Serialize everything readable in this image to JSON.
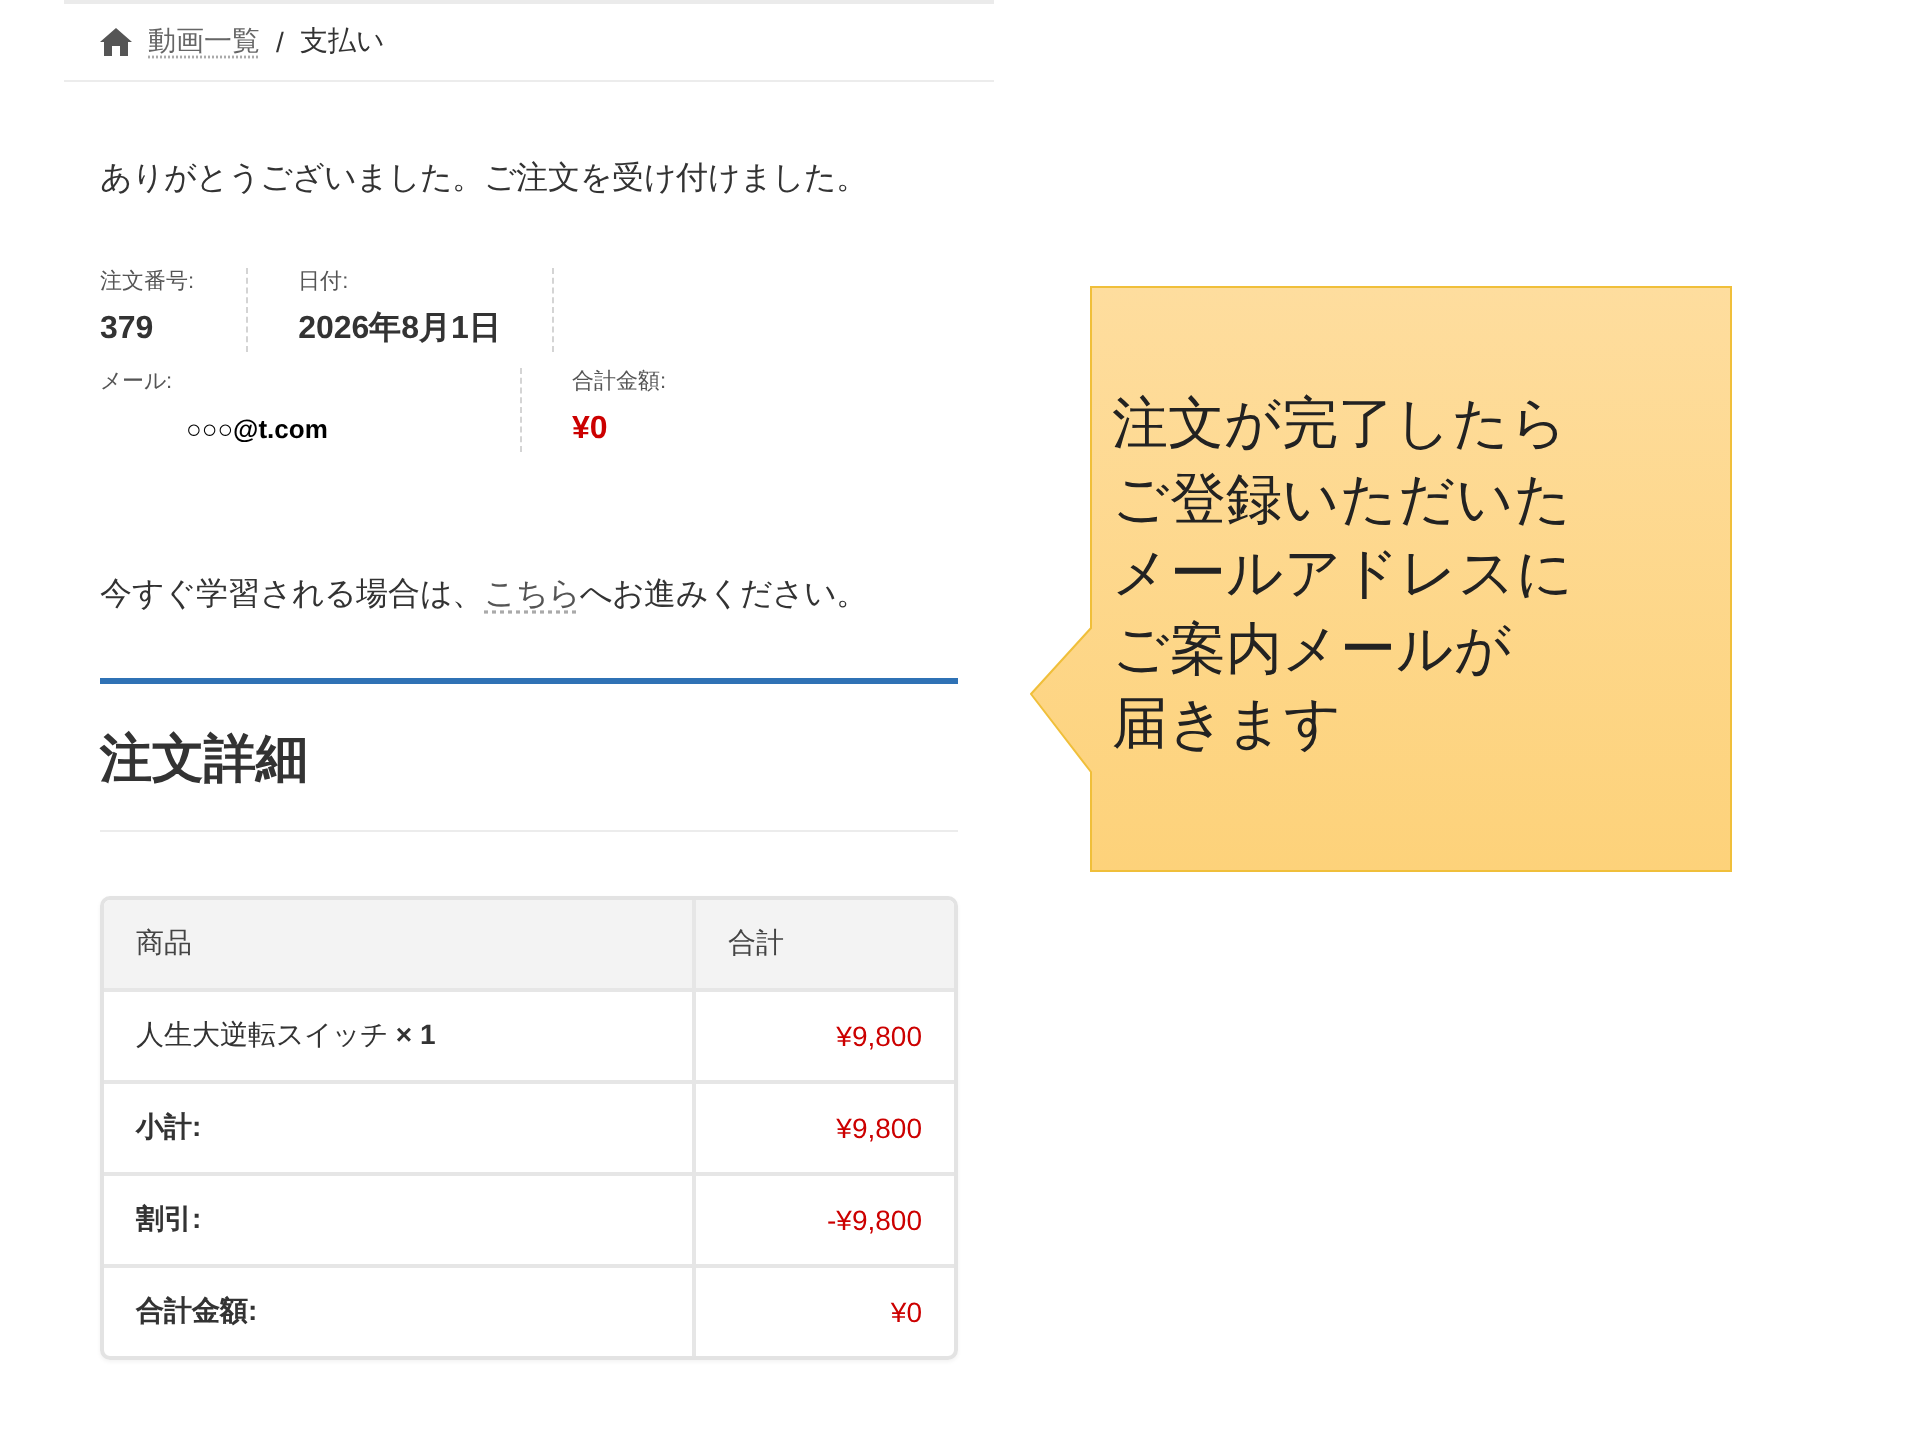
{
  "breadcrumb": {
    "items": [
      {
        "label": "動画一覧",
        "kind": "link"
      },
      {
        "label": "支払い",
        "kind": "current"
      }
    ],
    "separator": "/"
  },
  "thank_you": "ありがとうございました。ご注文を受け付けました。",
  "order_overview": [
    {
      "label": "注文番号:",
      "value": "379",
      "kind": "plain"
    },
    {
      "label": "日付:",
      "value": "2026年8月1日",
      "kind": "plain"
    },
    {
      "label": "メール:",
      "value": "○○○@t.com",
      "kind": "email"
    },
    {
      "label": "合計金額:",
      "value": "¥0",
      "kind": "price"
    }
  ],
  "next_step": {
    "text_before": "今すぐ学習される場合は、",
    "link": "こちら",
    "text_after": "へお進みください。"
  },
  "order_details": {
    "title": "注文詳細",
    "columns": [
      "商品",
      "合計"
    ],
    "rows": [
      {
        "kind": "item",
        "label": "人生大逆転スイッチ **× 1**",
        "amount": "¥9,800"
      },
      {
        "kind": "summary",
        "label": "小計:",
        "amount": "¥9,800"
      },
      {
        "kind": "summary",
        "label": "割引:",
        "amount": "-¥9,800"
      },
      {
        "kind": "summary",
        "label": "合計金額:",
        "amount": "¥0"
      }
    ]
  },
  "callout": {
    "lines": [
      "注文が完了したら",
      "ご登録いただいた",
      "メールアドレスに",
      "ご案内メールが",
      "届きます"
    ]
  }
}
